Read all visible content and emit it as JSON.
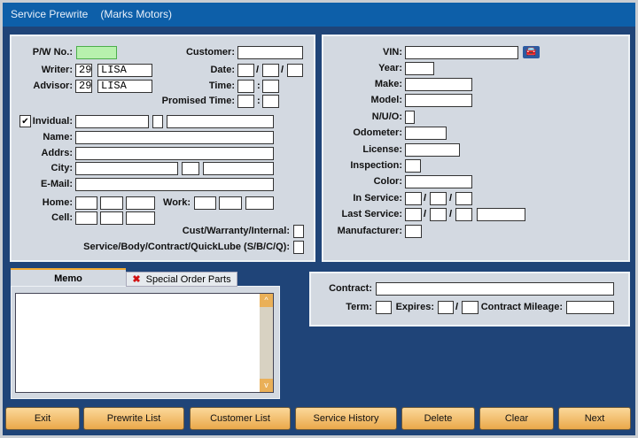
{
  "title": {
    "app": "Service Prewrite",
    "dealer": "(Marks Motors)"
  },
  "left": {
    "pw_no": "P/W No.:",
    "customer": "Customer:",
    "writer": "Writer:",
    "writer_id": "29",
    "writer_name": "LISA",
    "date": "Date:",
    "advisor": "Advisor:",
    "advisor_id": "29",
    "advisor_name": "LISA",
    "time": "Time:",
    "promised_time": "Promised Time:",
    "individual": "Invidual:",
    "individual_checked": true,
    "name": "Name:",
    "addrs": "Addrs:",
    "city": "City:",
    "email": "E-Mail:",
    "home": "Home:",
    "work": "Work:",
    "cell": "Cell:",
    "cust_warranty": "Cust/Warranty/Internal:",
    "service_body": "Service/Body/Contract/QuickLube (S/B/C/Q):",
    "slash": "/",
    "colon": ":",
    "check": "✔"
  },
  "right": {
    "vin": "VIN:",
    "year": "Year:",
    "make": "Make:",
    "model": "Model:",
    "nuo": "N/U/O:",
    "odometer": "Odometer:",
    "license": "License:",
    "inspection": "Inspection:",
    "color": "Color:",
    "in_service": "In Service:",
    "last_service": "Last Service:",
    "manufacturer": "Manufacturer:"
  },
  "contract": {
    "contract": "Contract:",
    "term": "Term:",
    "expires": "Expires:",
    "mileage": "Contract Mileage:"
  },
  "tabs": {
    "memo": "Memo",
    "special": "Special Order Parts",
    "x": "✖"
  },
  "buttons": {
    "exit": "Exit",
    "prewrite": "Prewrite List",
    "customer": "Customer List",
    "history": "Service History",
    "delete": "Delete",
    "clear": "Clear",
    "next": "Next"
  }
}
